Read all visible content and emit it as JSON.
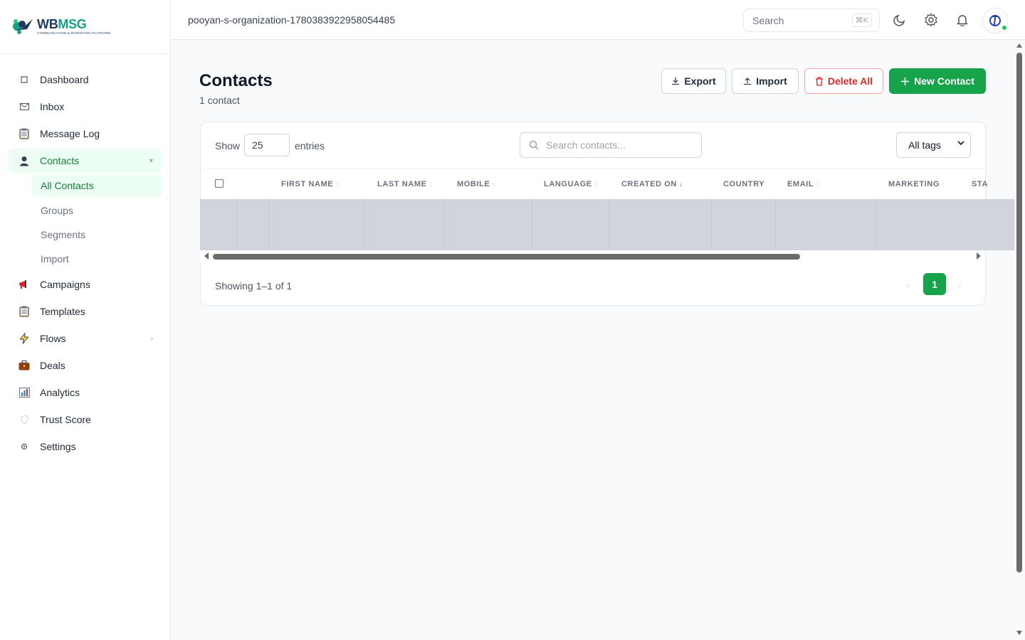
{
  "brand": {
    "name_part1": "WB",
    "name_part2": "MSG",
    "tagline": "COMMUNICATION & MARKETING PLATFORM"
  },
  "sidebar": {
    "items": [
      {
        "label": "Dashboard",
        "icon": "square-icon"
      },
      {
        "label": "Inbox",
        "icon": "mail-icon"
      },
      {
        "label": "Message Log",
        "icon": "clipboard-icon"
      },
      {
        "label": "Contacts",
        "icon": "person-icon"
      },
      {
        "label": "Campaigns",
        "icon": "megaphone-icon"
      },
      {
        "label": "Templates",
        "icon": "clipboard-icon"
      },
      {
        "label": "Flows",
        "icon": "lightning-icon"
      },
      {
        "label": "Deals",
        "icon": "briefcase-icon"
      },
      {
        "label": "Analytics",
        "icon": "bar-chart-icon"
      },
      {
        "label": "Trust Score",
        "icon": "shield-icon"
      },
      {
        "label": "Settings",
        "icon": "gear-icon"
      }
    ],
    "contacts_sub": [
      "All Contacts",
      "Groups",
      "Segments",
      "Import"
    ]
  },
  "header": {
    "org": "pooyan-s-organization-1780383922958054485",
    "search_placeholder": "Search",
    "shortcut": "⌘K"
  },
  "page": {
    "title": "Contacts",
    "count": "1 contact"
  },
  "actions": {
    "export": "Export",
    "import": "Import",
    "delete_all": "Delete All",
    "new_contact": "New Contact"
  },
  "table_controls": {
    "show": "Show",
    "page_size": "25",
    "entries": "entries",
    "search_placeholder": "Search contacts...",
    "tag_filter": "All tags"
  },
  "columns": [
    "FIRST NAME",
    "LAST NAME",
    "MOBILE",
    "LANGUAGE",
    "CREATED ON",
    "COUNTRY",
    "EMAIL",
    "MARKETING",
    "STA"
  ],
  "pagination": {
    "summary": "Showing 1–1 of 1",
    "prev": "‹",
    "current": "1",
    "next": "›"
  },
  "colors": {
    "accent": "#16a34a",
    "danger": "#dc2626",
    "active_bg": "#ecfdf3"
  }
}
